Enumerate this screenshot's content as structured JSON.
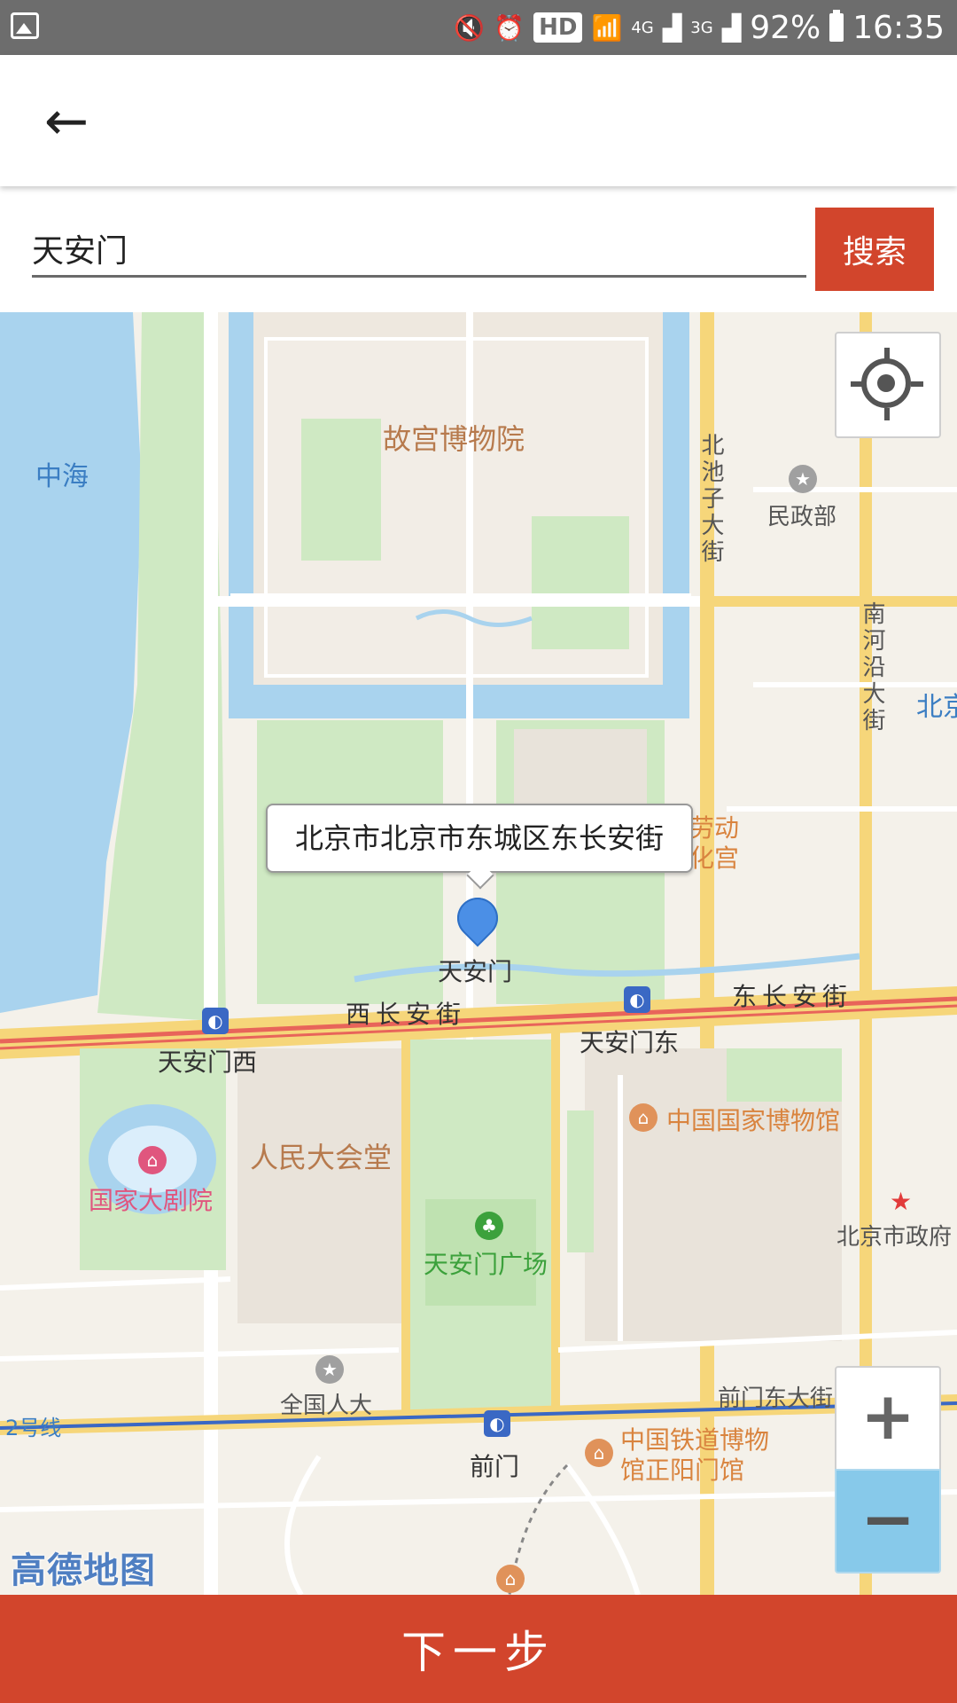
{
  "status_bar": {
    "network_4g": "4G",
    "network_3g": "3G",
    "hd": "HD",
    "battery": "92%",
    "time": "16:35"
  },
  "app_bar": {
    "back_icon": "arrow-left-icon"
  },
  "search": {
    "value": "天安门",
    "button_label": "搜索"
  },
  "map": {
    "tooltip": "北京市北京市东城区东长安街",
    "labels": {
      "palace_museum": "故宫博物院",
      "zhonghai": "中海",
      "minzhengbu": "民政部",
      "beichizi": "北池子大街",
      "nanheyan": "南河沿大街",
      "beijing_partial": "北京",
      "laodong_1": "劳动",
      "laodong_2": "化宫",
      "tiananmen": "天安门",
      "xichangan": "西长安街",
      "dongchangan": "东长安街",
      "tiananmen_xi": "天安门西",
      "tiananmen_dong": "天安门东",
      "national_museum": "中国国家博物馆",
      "great_hall": "人民大会堂",
      "national_theatre": "国家大剧院",
      "tiananmen_square": "天安门广场",
      "beijing_gov": "北京市政府",
      "npc": "全国人大",
      "line2": "2号线",
      "qianmen_dongda": "前门东大街",
      "railway_museum_1": "中国铁道博物",
      "railway_museum_2": "馆正阳门馆",
      "qianmen": "前门"
    },
    "zoom_in": "+",
    "zoom_out": "−",
    "logo": "高德地图",
    "colors": {
      "water": "#a9d3ee",
      "green": "#cfe9c3",
      "road_main": "#f6d67a",
      "road_red": "#e8645a",
      "base": "#f4f1ea"
    }
  },
  "next_button": "下一步"
}
